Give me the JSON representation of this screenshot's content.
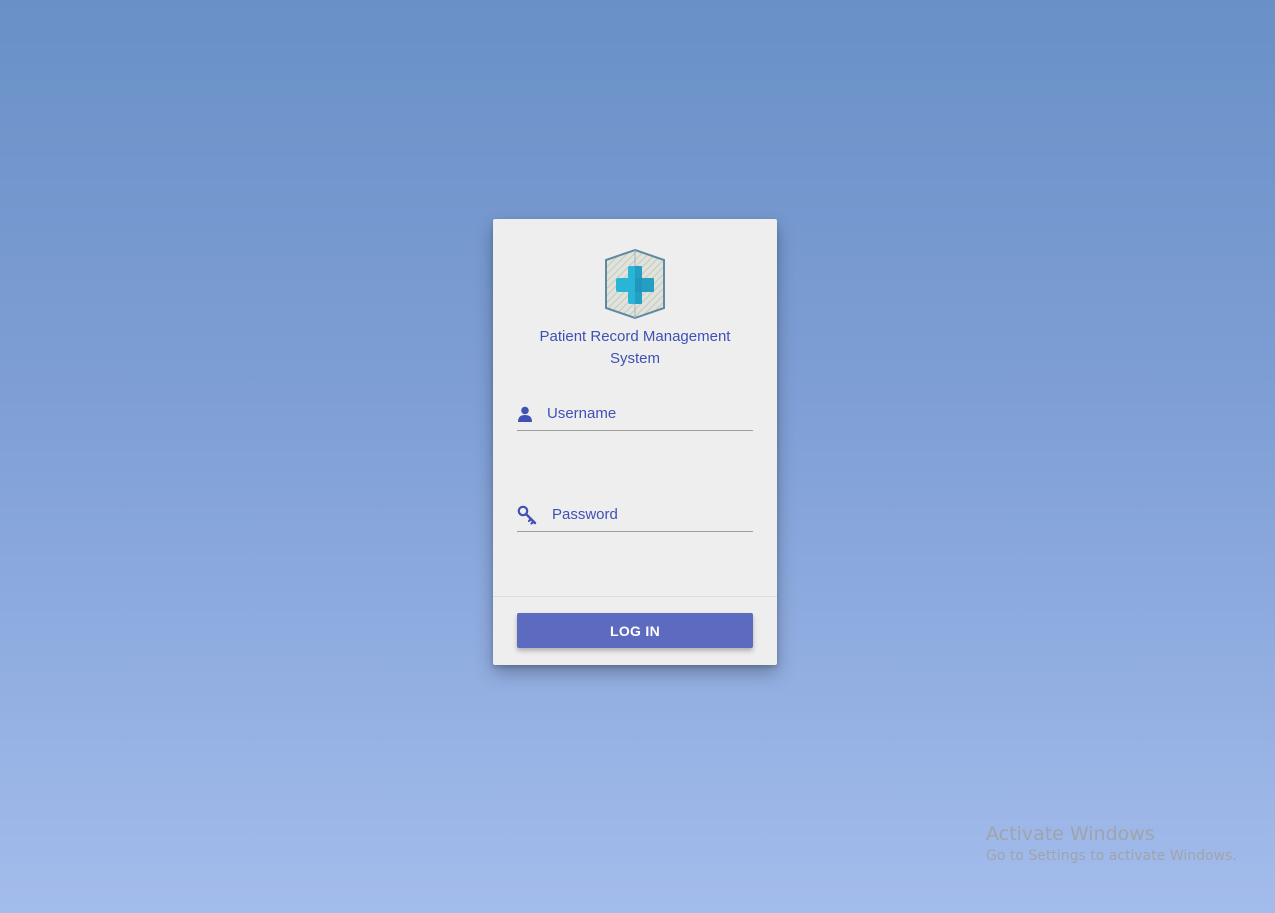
{
  "app": {
    "title": "Patient Record Management System"
  },
  "login": {
    "username_placeholder": "Username",
    "username_value": "",
    "password_placeholder": "Password",
    "password_value": "",
    "submit_label": "LOG IN"
  },
  "icons": {
    "logo": "medical-cross-shield-icon",
    "username": "user-icon",
    "password": "key-icon"
  },
  "colors": {
    "accent": "#3f51b5",
    "button": "#5c6bc0",
    "logo_cross": "#29b6d6",
    "card": "#eeeeee"
  },
  "system_watermark": {
    "title": "Activate Windows",
    "subtitle": "Go to Settings to activate Windows."
  }
}
